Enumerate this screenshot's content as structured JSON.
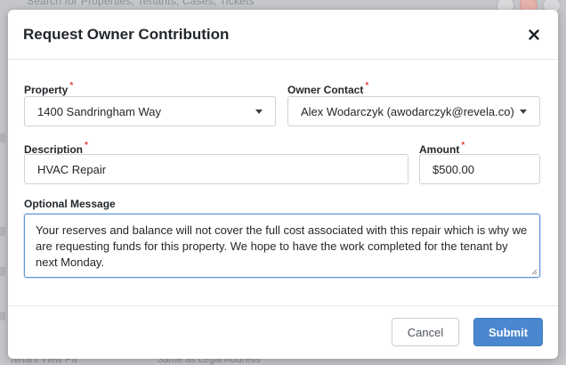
{
  "background": {
    "search_text": "Search for Properties, Tenants, Cases, Tickets",
    "footer_left": "Tenant View Pa",
    "footer_right": "Same as Legal Address"
  },
  "modal": {
    "title": "Request Owner Contribution",
    "close_icon": "close-icon",
    "fields": {
      "property": {
        "label": "Property",
        "required_mark": "*",
        "value": "1400 Sandringham Way"
      },
      "owner_contact": {
        "label": "Owner Contact",
        "required_mark": "*",
        "value": "Alex Wodarczyk (awodarczyk@revela.co)"
      },
      "description": {
        "label": "Description",
        "required_mark": "*",
        "value": "HVAC Repair"
      },
      "amount": {
        "label": "Amount",
        "required_mark": "*",
        "value": "$500.00"
      },
      "optional_message": {
        "label": "Optional Message",
        "value": "Your reserves and balance will not cover the full cost associated with this repair which is why we are requesting funds for this property. We hope to have the work completed for the tenant by next Monday."
      }
    },
    "footer": {
      "cancel_label": "Cancel",
      "submit_label": "Submit"
    }
  },
  "colors": {
    "accent": "#4a87cf",
    "required": "#e0463c",
    "overlay": "#c4c6c9"
  }
}
